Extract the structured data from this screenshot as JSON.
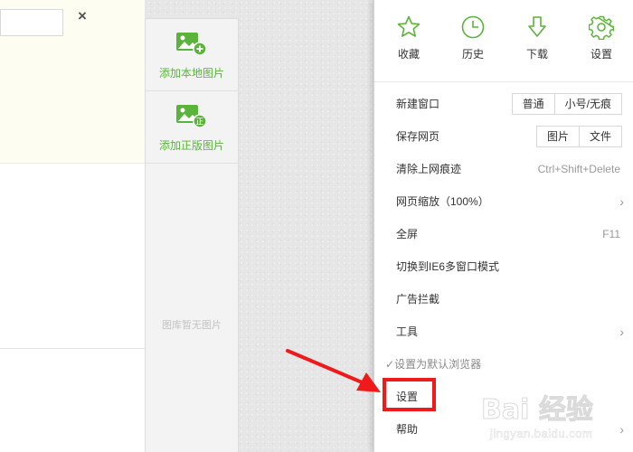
{
  "editor": {
    "close_symbol": "×",
    "title_value": ""
  },
  "image_panel": {
    "add_local_label": "添加本地图片",
    "add_licensed_label": "添加正版图片",
    "empty_text": "图库暂无图片",
    "licensed_badge": "正"
  },
  "menu": {
    "quick_actions": [
      {
        "label": "收藏",
        "icon": "star-icon"
      },
      {
        "label": "历史",
        "icon": "clock-icon"
      },
      {
        "label": "下载",
        "icon": "download-arrow-icon"
      },
      {
        "label": "设置",
        "icon": "gear-icon"
      }
    ],
    "new_window": {
      "label": "新建窗口",
      "options": [
        "普通",
        "小号/无痕"
      ]
    },
    "save_page": {
      "label": "保存网页",
      "options": [
        "图片",
        "文件"
      ]
    },
    "clear_history": {
      "label": "清除上网痕迹",
      "shortcut": "Ctrl+Shift+Delete"
    },
    "zoom": {
      "label": "网页缩放（100%）",
      "arrow": "›"
    },
    "fullscreen": {
      "label": "全屏",
      "shortcut": "F11"
    },
    "ie6_mode": {
      "label": "切换到IE6多窗口模式"
    },
    "ad_block": {
      "label": "广告拦截"
    },
    "tools": {
      "label": "工具",
      "arrow": "›"
    },
    "default_browser": {
      "label": "设置为默认浏览器",
      "check": "✓"
    },
    "settings": {
      "label": "设置"
    },
    "help": {
      "label": "帮助",
      "arrow": "›"
    }
  },
  "colors": {
    "accent_green": "#5bb33b",
    "annotation_red": "#ef1b1b"
  },
  "watermark": {
    "logo": "Bai 经验",
    "url": "jingyan.baidu.com"
  }
}
